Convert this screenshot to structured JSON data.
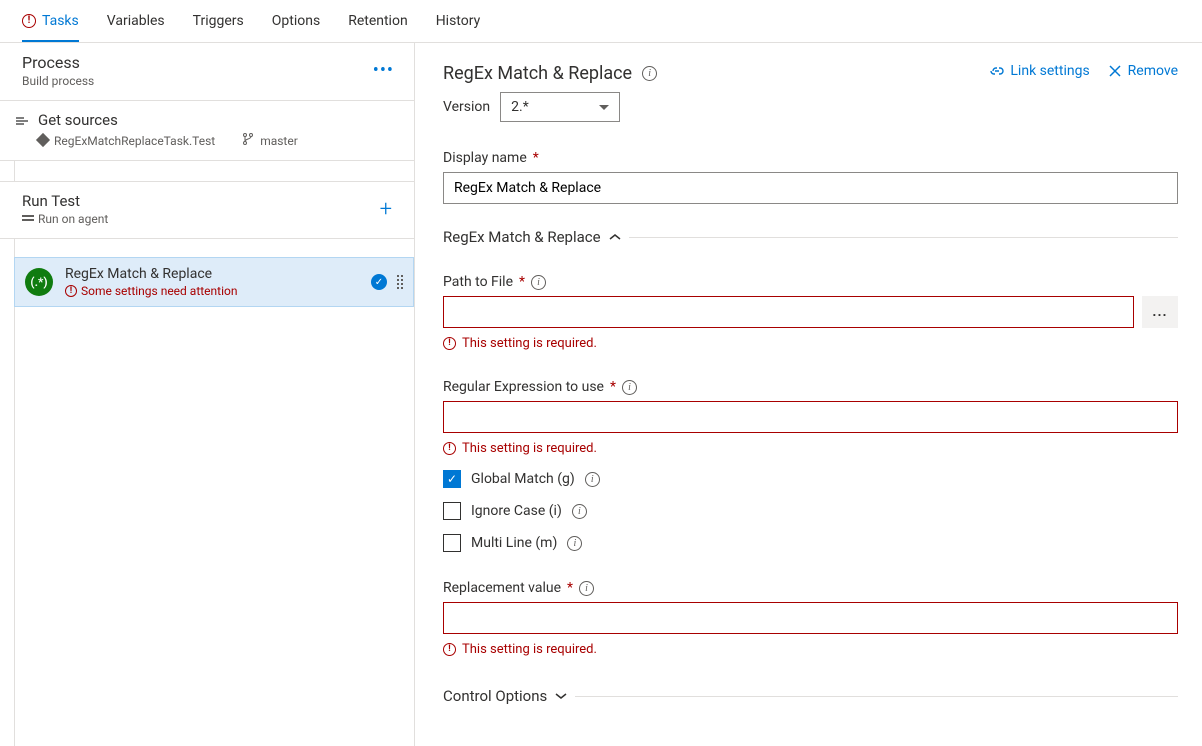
{
  "tabs": {
    "tasks": "Tasks",
    "variables": "Variables",
    "triggers": "Triggers",
    "options": "Options",
    "retention": "Retention",
    "history": "History"
  },
  "process": {
    "title": "Process",
    "subtitle": "Build process"
  },
  "sources": {
    "title": "Get sources",
    "repo": "RegExMatchReplaceTask.Test",
    "branch": "master"
  },
  "job": {
    "title": "Run Test",
    "subtitle": "Run on agent"
  },
  "task": {
    "title": "RegEx Match & Replace",
    "warning": "Some settings need attention",
    "icon_text": "(.*)"
  },
  "detail": {
    "title": "RegEx Match & Replace",
    "link_settings": "Link settings",
    "remove": "Remove",
    "version_label": "Version",
    "version_value": "2.*",
    "display_name_label": "Display name",
    "display_name_value": "RegEx Match & Replace",
    "section_title": "RegEx Match & Replace",
    "path_label": "Path to File",
    "path_value": "",
    "regex_label": "Regular Expression to use",
    "regex_value": "",
    "global_label": "Global Match (g)",
    "ignore_label": "Ignore Case (i)",
    "multi_label": "Multi Line (m)",
    "replacement_label": "Replacement value",
    "replacement_value": "",
    "required_msg": "This setting is required.",
    "control_options": "Control Options"
  }
}
